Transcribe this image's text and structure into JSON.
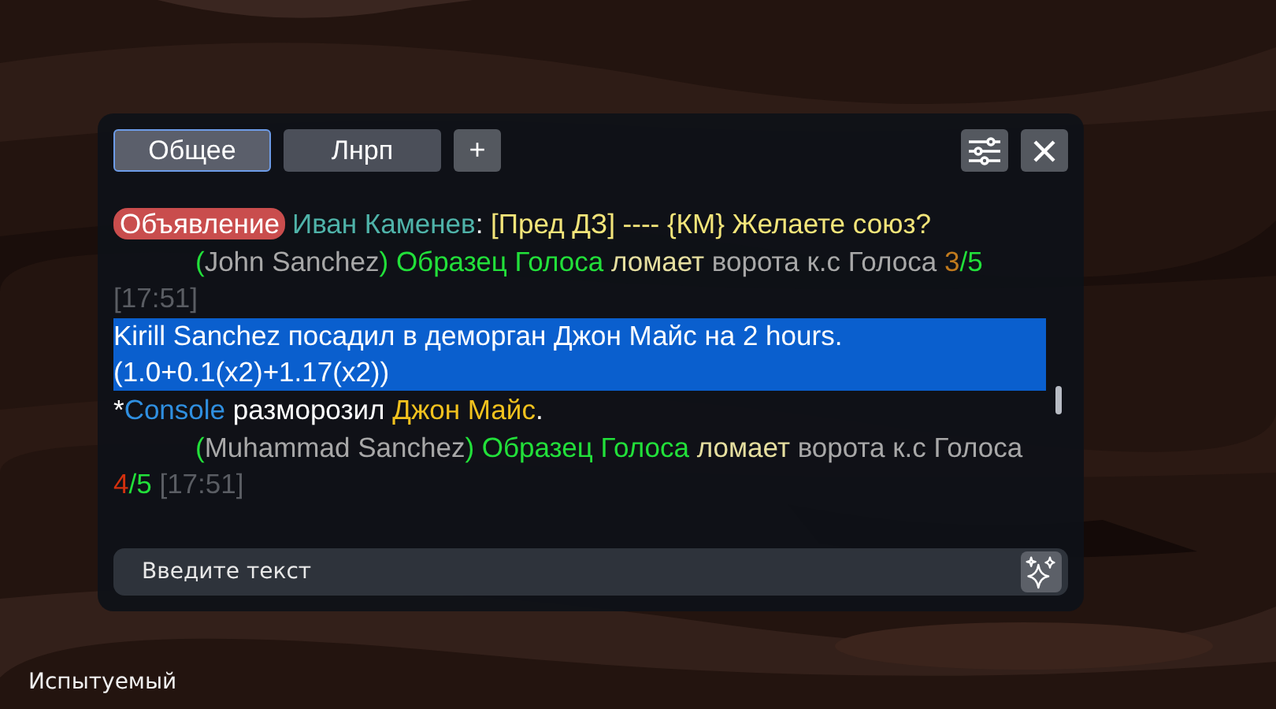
{
  "tabs": [
    {
      "label": "Общее",
      "selected": true
    },
    {
      "label": "Лнрп",
      "selected": false
    }
  ],
  "add_tab_button": {
    "label": "+"
  },
  "messages": [
    {
      "badge": "Объявление",
      "indent": false,
      "selected": false,
      "segments": [
        {
          "text": "Иван Каменев",
          "color": "#4fb3a9"
        },
        {
          "text": ": ",
          "color": "#ffffff"
        },
        {
          "text": "[Пред ДЗ] ---- {КМ} Желаете союз?",
          "color": "#f3e57a"
        }
      ]
    },
    {
      "indent": true,
      "selected": false,
      "segments": [
        {
          "text": "(",
          "color": "#22e03a"
        },
        {
          "text": "John Sanchez",
          "color": "#a8a8a8"
        },
        {
          "text": ") Образец Голоса ",
          "color": "#22e03a"
        },
        {
          "text": "ломает ",
          "color": "#e6dfa0"
        },
        {
          "text": "ворота к.с Голоса ",
          "color": "#a8a8a8"
        },
        {
          "text": "3",
          "color": "#c07a1e"
        },
        {
          "text": "/5 ",
          "color": "#22e03a"
        },
        {
          "text": "[17:51]",
          "color": "#5a5d63"
        }
      ]
    },
    {
      "indent": false,
      "selected": true,
      "segments": [
        {
          "text": "Kirill Sanchez посадил в деморган Джон Майс на 2 hours. (1.0+0.1(x2)+1.17(x2))",
          "color": "#ffffff"
        }
      ]
    },
    {
      "indent": false,
      "selected": false,
      "segments": [
        {
          "text": "*",
          "color": "#ffffff"
        },
        {
          "text": "Console",
          "color": "#2f8fe0"
        },
        {
          "text": " разморозил ",
          "color": "#ffffff"
        },
        {
          "text": "Джон Майс",
          "color": "#f2c21e"
        },
        {
          "text": ".",
          "color": "#ffffff"
        }
      ]
    },
    {
      "indent": true,
      "selected": false,
      "segments": [
        {
          "text": "(",
          "color": "#22e03a"
        },
        {
          "text": "Muhammad Sanchez",
          "color": "#a8a8a8"
        },
        {
          "text": ") Образец Голоса ",
          "color": "#22e03a"
        },
        {
          "text": "ломает ",
          "color": "#e6dfa0"
        },
        {
          "text": "ворота к.с Голоса ",
          "color": "#a8a8a8"
        },
        {
          "text": "4",
          "color": "#d2300e"
        },
        {
          "text": "/5 ",
          "color": "#22e03a"
        },
        {
          "text": "[17:51]",
          "color": "#5a5d63"
        }
      ]
    }
  ],
  "input": {
    "placeholder": "Введите текст"
  },
  "player_label": "Испытуемый"
}
